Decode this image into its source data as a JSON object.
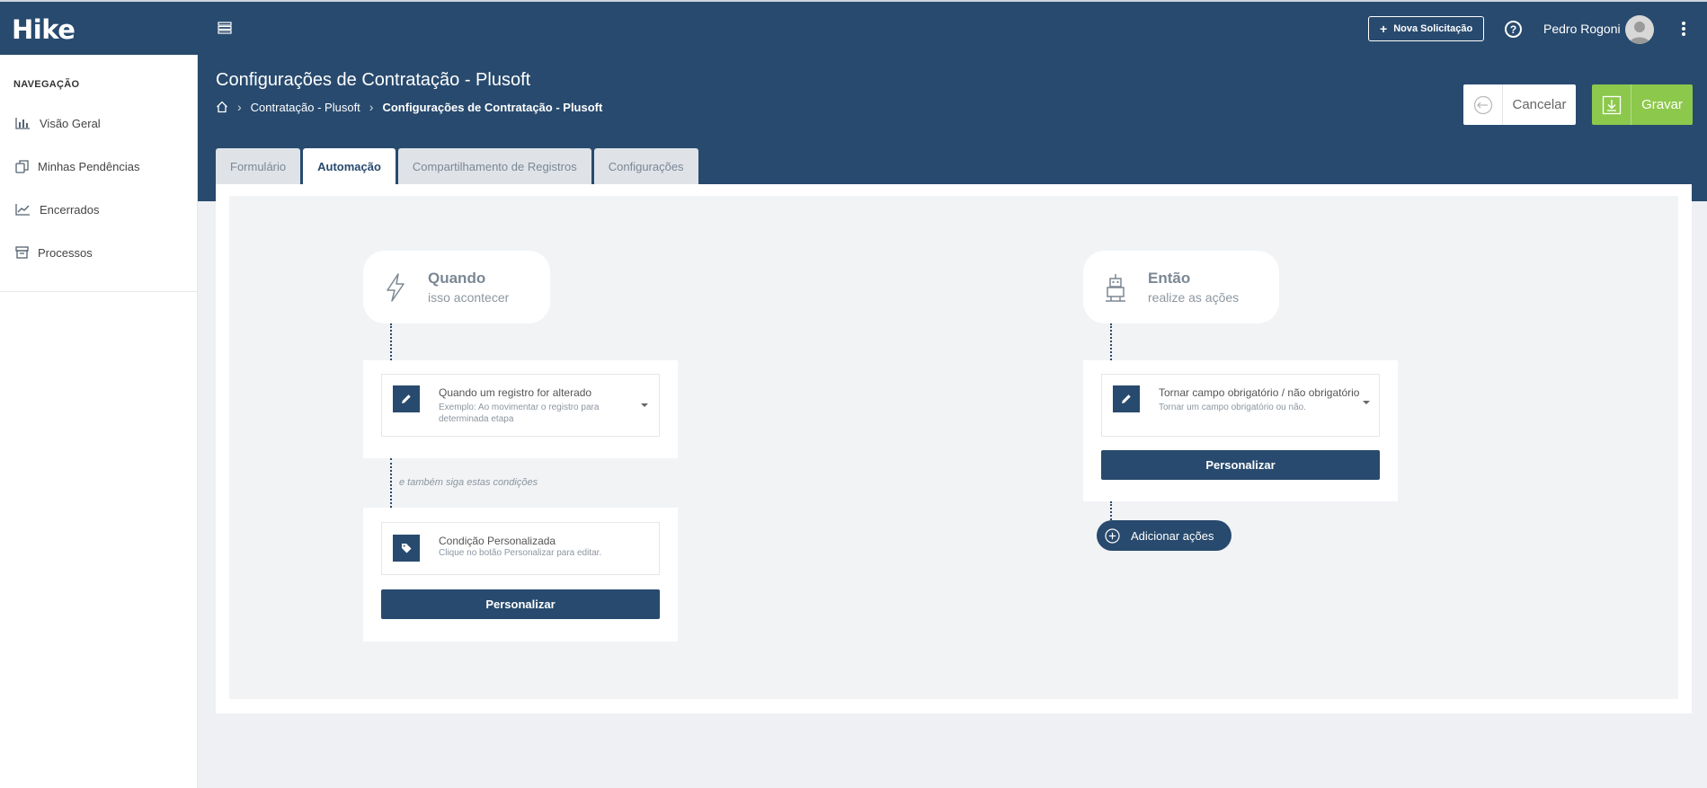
{
  "app": {
    "logo": "Hike",
    "new_request_label": "Nova Solicitação",
    "help_label": "?",
    "user_name": "Pedro Rogoni"
  },
  "sidebar": {
    "heading": "NAVEGAÇÃO",
    "items": [
      {
        "label": "Visão Geral",
        "icon": "bar-chart-icon"
      },
      {
        "label": "Minhas Pendências",
        "icon": "copy-icon"
      },
      {
        "label": "Encerrados",
        "icon": "line-chart-icon"
      },
      {
        "label": "Processos",
        "icon": "archive-icon"
      }
    ]
  },
  "header": {
    "title": "Configurações de Contratação - Plusoft",
    "breadcrumb": [
      "Contratação - Plusoft",
      "Configurações de Contratação - Plusoft"
    ],
    "cancel_label": "Cancelar",
    "save_label": "Gravar"
  },
  "tabs": [
    {
      "label": "Formulário",
      "active": false
    },
    {
      "label": "Automação",
      "active": true
    },
    {
      "label": "Compartilhamento de Registros",
      "active": false
    },
    {
      "label": "Configurações",
      "active": false
    }
  ],
  "automation": {
    "when": {
      "title": "Quando",
      "subtitle": "isso acontecer",
      "trigger_title": "Quando um registro for alterado",
      "trigger_desc": "Exemplo: Ao movimentar o registro para determinada etapa",
      "conditions_text": "e também siga estas condições",
      "condition_title": "Condição Personalizada",
      "condition_desc": "Clique no botão Personalizar para editar.",
      "customize_label": "Personalizar"
    },
    "then": {
      "title": "Então",
      "subtitle": "realize as ações",
      "action_title": "Tornar campo obrigatório / não obrigatório",
      "action_desc": "Tornar um campo obrigatório ou não.",
      "customize_label": "Personalizar",
      "add_actions_label": "Adicionar ações"
    }
  },
  "colors": {
    "primary": "#284a6e",
    "success": "#8cc84b",
    "canvas": "#f1f3f5"
  }
}
